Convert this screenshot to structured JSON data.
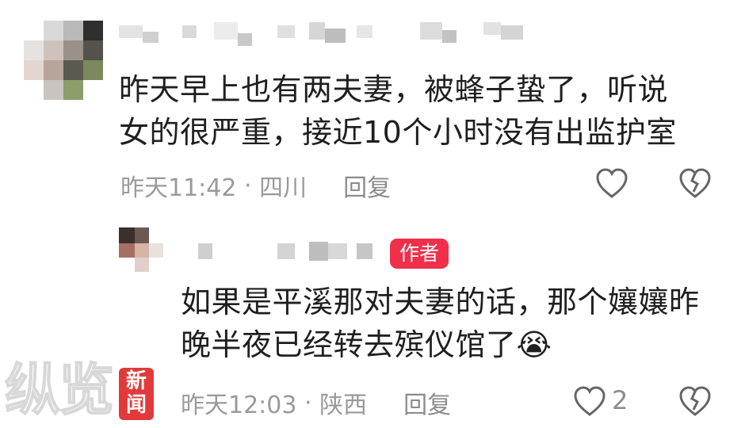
{
  "comments": [
    {
      "text_line1": "昨天早上也有两夫妻，被蜂子蛰了，听说",
      "text_line2": "女的很严重，接近10个小时没有出监护室",
      "time": "昨天11:42",
      "location": "四川",
      "reply_label": "回复"
    },
    {
      "author_badge": "作者",
      "text_line1": "如果是平溪那对夫妻的话，那个孃孃昨",
      "text_line2": "晚半夜已经转去殡仪馆了😭",
      "time": "昨天12:03",
      "location": "陕西",
      "reply_label": "回复",
      "like_count": "2"
    }
  ],
  "watermark": {
    "brand": "纵览",
    "badge_line1": "新",
    "badge_line2": "闻"
  },
  "colors": {
    "badge": "#f0304a",
    "meta": "#9a9a9a",
    "text": "#1f1f1f"
  }
}
